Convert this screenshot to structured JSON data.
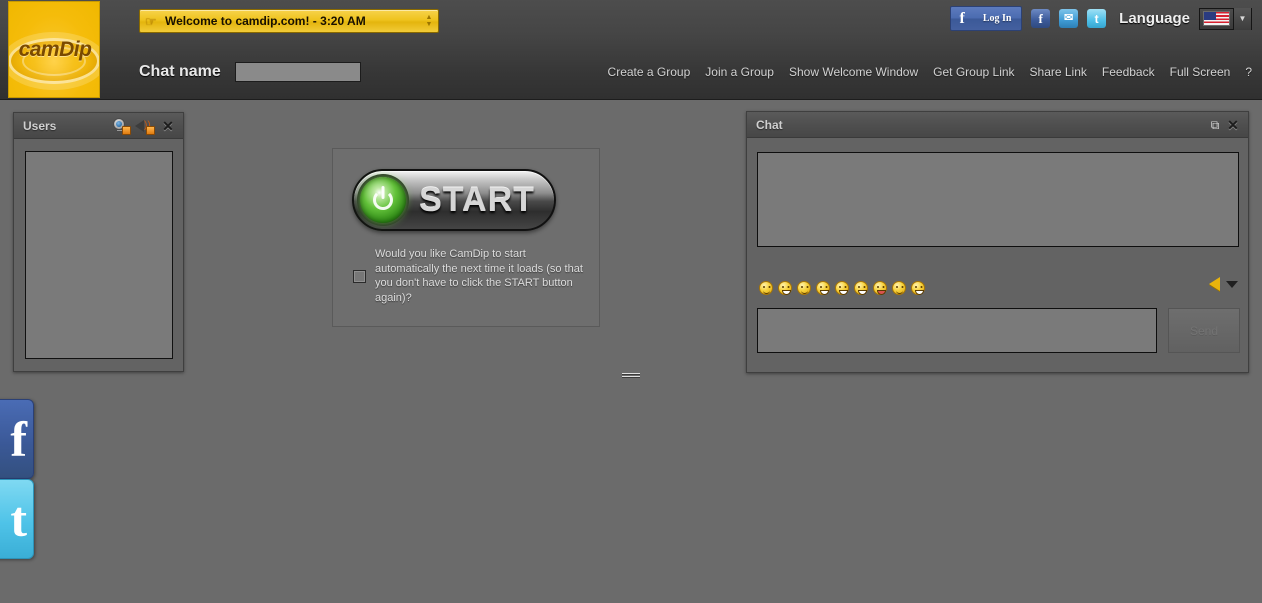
{
  "header": {
    "logo_text": "camDip",
    "welcome_bar": {
      "icon": "pointing-hand-icon",
      "text": "Welcome to camdip.com! - 3:20 AM"
    },
    "chat_name_label": "Chat name",
    "chat_name_value": "",
    "chat_name_placeholder": "",
    "facebook_login": {
      "icon": "facebook-f-icon",
      "label": "Log In"
    },
    "share_icons": [
      {
        "name": "facebook-share-icon",
        "glyph": "f"
      },
      {
        "name": "email-share-icon",
        "glyph": "✉"
      },
      {
        "name": "twitter-share-icon",
        "glyph": "t"
      }
    ],
    "language_label": "Language",
    "language_flag": "us-flag-icon",
    "language_arrow": "▼",
    "nav_links": [
      "Create a Group",
      "Join a Group",
      "Show Welcome Window",
      "Get Group Link",
      "Share Link",
      "Feedback",
      "Full Screen",
      "?"
    ]
  },
  "users_panel": {
    "title": "Users",
    "webcam_icon": "webcam-permission-icon",
    "speaker_icon": "speaker-permission-icon",
    "close_icon": "✕",
    "list_items": []
  },
  "start_box": {
    "button_label": "START",
    "power_icon": "power-icon",
    "checkbox_checked": false,
    "auto_start_text": "Would you like CamDip to start automatically the next time it loads (so that you don't have to click the START button again)?"
  },
  "chat_panel": {
    "title": "Chat",
    "popout_icon": "⧉",
    "close_icon": "✕",
    "messages": [],
    "emojis": [
      {
        "name": "emoji-smile",
        "mod": ""
      },
      {
        "name": "emoji-grin",
        "mod": "grin"
      },
      {
        "name": "emoji-happy",
        "mod": ""
      },
      {
        "name": "emoji-laugh",
        "mod": "grin"
      },
      {
        "name": "emoji-big-grin",
        "mod": "grin"
      },
      {
        "name": "emoji-teeth",
        "mod": "grin"
      },
      {
        "name": "emoji-tongue",
        "mod": "tongue"
      },
      {
        "name": "emoji-neutral",
        "mod": ""
      },
      {
        "name": "emoji-wink",
        "mod": "grin"
      }
    ],
    "sound_icon": "sound-bell-icon",
    "sound_dropdown_icon": "▼",
    "message_value": "",
    "message_placeholder": "",
    "send_label": "Send"
  },
  "resize_handle": "panel-resize-handle",
  "social_float": [
    {
      "name": "facebook-float-button",
      "glyph": "f"
    },
    {
      "name": "twitter-float-button",
      "glyph": "t"
    }
  ],
  "colors": {
    "background": "#6b6b6b",
    "header_dark": "#3a3a3a",
    "brand_yellow": "#f0b800",
    "facebook_blue": "#3b5998",
    "twitter_blue": "#4fc3e8",
    "panel_gray": "#636363",
    "field_gray": "#7a7a7a"
  }
}
